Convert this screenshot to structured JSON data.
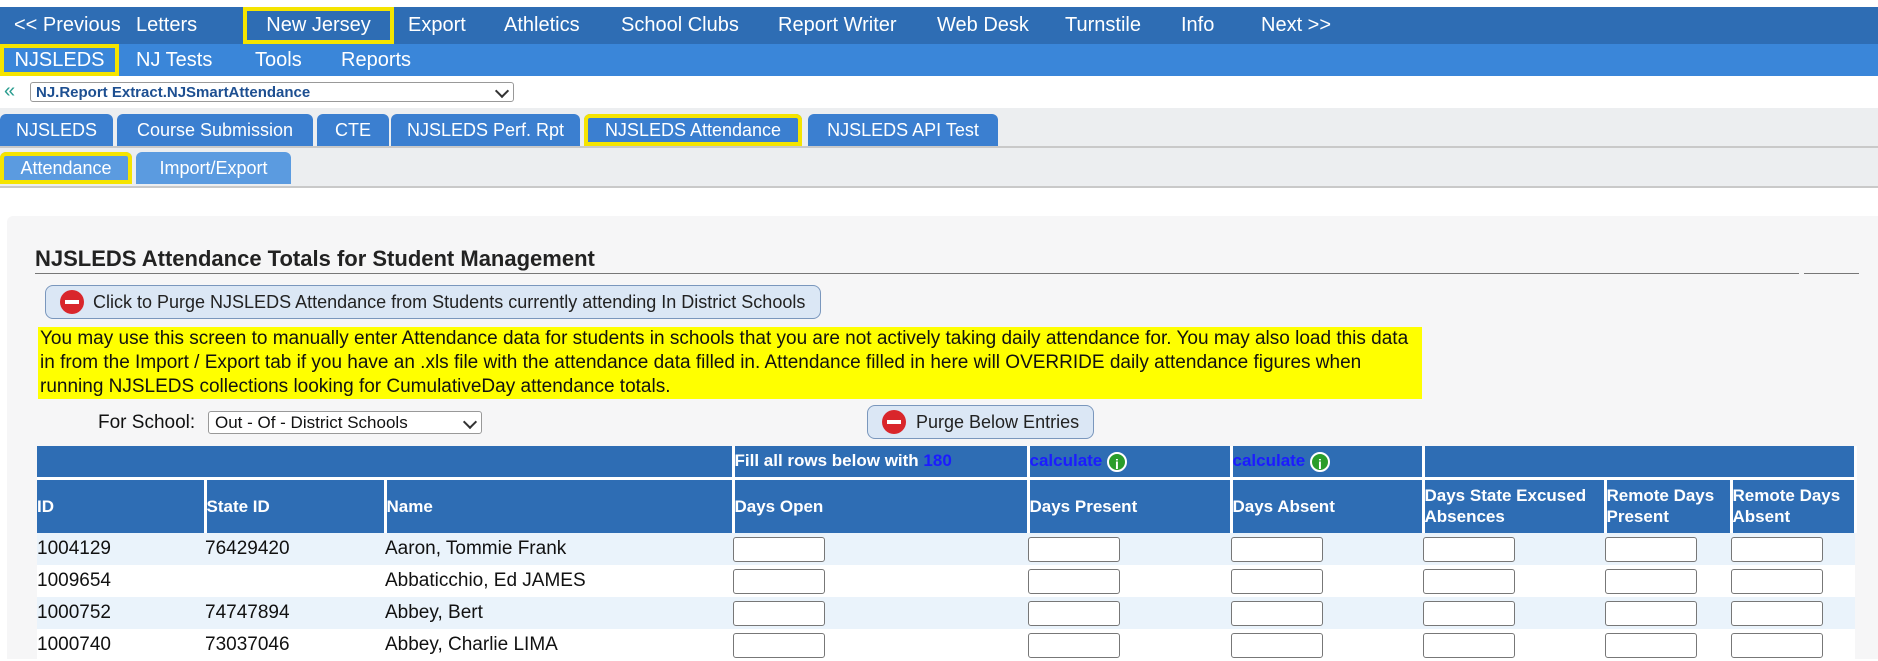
{
  "topnav": {
    "items": [
      "<< Previous",
      "Letters",
      "New Jersey",
      "Export",
      "Athletics",
      "School Clubs",
      "Report Writer",
      "Web Desk",
      "Turnstile",
      "Info",
      "Next >>"
    ]
  },
  "subnav": {
    "items": [
      "NJSLEDS",
      "NJ Tests",
      "Tools",
      "Reports"
    ]
  },
  "report_select": {
    "value": "NJ.Report Extract.NJSmartAttendance"
  },
  "tabs": [
    "NJSLEDS",
    "Course Submission",
    "CTE",
    "NJSLEDS Perf. Rpt",
    "NJSLEDS Attendance",
    "NJSLEDS API Test"
  ],
  "subtabs": [
    "Attendance",
    "Import/Export"
  ],
  "page": {
    "title": "NJSLEDS Attendance Totals for Student Management",
    "purge_all_label": "Click to Purge NJSLEDS Attendance from Students currently attending In District Schools",
    "notice": "You may use this screen to manually enter Attendance data for students in schools that you are not actively taking daily attendance for. You may also load this data in from the Import / Export tab if you have an .xls file with the attendance data filled in. Attendance filled in here will OVERRIDE daily attendance figures when running NJSLEDS collections looking for CumulativeDay attendance totals.",
    "school_label": "For School:",
    "school_value": "Out - Of - District Schools",
    "purge_below_label": "Purge Below Entries"
  },
  "table": {
    "fill_label": "Fill all rows below with",
    "fill_value": "180",
    "calculate_label": "calculate",
    "info_icon_glyph": "i",
    "columns": [
      "ID",
      "State ID",
      "Name",
      "Days Open",
      "Days Present",
      "Days Absent",
      "Days State Excused Absences",
      "Remote Days Present",
      "Remote Days Absent"
    ],
    "rows": [
      {
        "id": "1004129",
        "state_id": "76429420",
        "name": "Aaron, Tommie Frank"
      },
      {
        "id": "1009654",
        "state_id": "",
        "name": "Abbaticchio, Ed JAMES"
      },
      {
        "id": "1000752",
        "state_id": "74747894",
        "name": "Abbey, Bert"
      },
      {
        "id": "1000740",
        "state_id": "73037046",
        "name": "Abbey, Charlie LIMA"
      }
    ]
  },
  "colors": {
    "nav_dark": "#2e6db4",
    "nav_light": "#3a86d9",
    "highlight": "#f5e400",
    "notice_bg": "#ffff00",
    "purge_red": "#d9262b"
  }
}
